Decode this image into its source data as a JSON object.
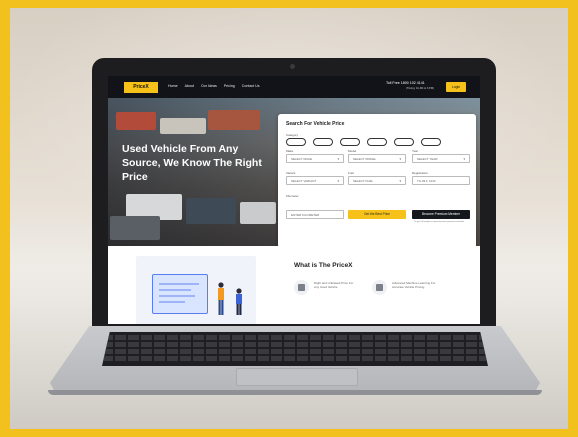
{
  "site": {
    "logo": "PriceX",
    "nav_links": [
      "Home",
      "About",
      "Our Ideas",
      "Pricing",
      "Contact Us"
    ],
    "phone": "Toll Free 1800 102 4141",
    "phone_sub": "(Timing: 10 AM to 6 PM)",
    "login_label": "Login"
  },
  "hero": {
    "title": "Used Vehicle From Any Source, We Know The Right Price"
  },
  "search_panel": {
    "title": "Search For Vehicle Price",
    "category_label": "Category",
    "fields": {
      "make": {
        "label": "Make",
        "value": "SELECT MAKE"
      },
      "model": {
        "label": "Model",
        "value": "SELECT MODEL"
      },
      "year": {
        "label": "Year",
        "value": "SELECT YEAR"
      },
      "variant": {
        "label": "Variant",
        "value": "SELECT VARIANT"
      },
      "fuel": {
        "label": "Fuel",
        "value": "SELECT FUEL"
      },
      "registration": {
        "label": "Registration",
        "value": "TG 09 F 1234"
      },
      "kilometer": {
        "label": "Kilometer",
        "value": "ENTER KILOMETER"
      }
    },
    "get_price_button": "Get the Best Price",
    "premium_button": "Become Premium Member",
    "note": "To get full analysis report become premium member"
  },
  "section_what": {
    "title": "What is The PriceX",
    "features": [
      "Right and Unbiased Price For Any Used Vehicle",
      "Advanced Machine Learning For Accurate Vehicle Pricing"
    ]
  },
  "colors": {
    "brand_yellow": "#f6c21a",
    "nav_dark": "#111318",
    "frame_yellow": "#f3c11d"
  }
}
